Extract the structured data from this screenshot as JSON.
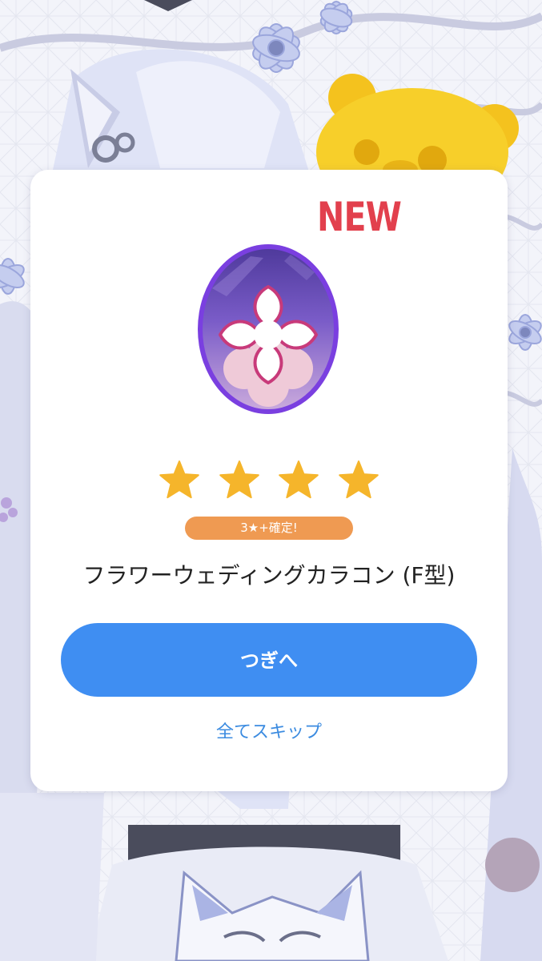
{
  "result": {
    "new_label": "NEW",
    "rarity_stars": 4,
    "guarantee_badge": "3★+確定!",
    "item_name": "フラワーウェディングカラコン (F型)"
  },
  "buttons": {
    "next_label": "つぎへ",
    "skip_all_label": "全てスキップ"
  },
  "colors": {
    "new_label": "#e2404d",
    "star": "#f5b52b",
    "badge": "#ef9a52",
    "next_button": "#3f8ef2",
    "skip_link": "#3b8be0"
  }
}
